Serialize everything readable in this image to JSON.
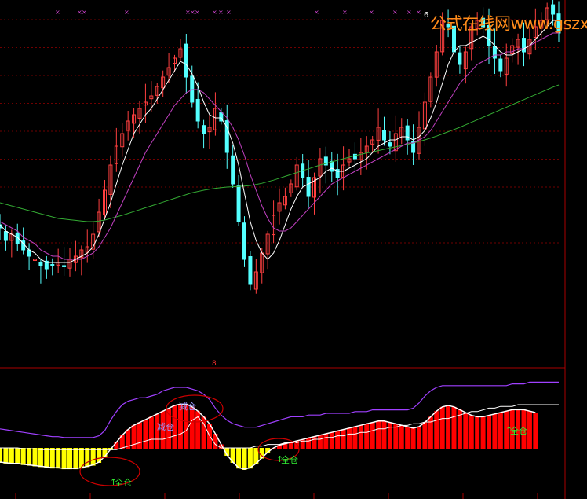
{
  "watermark": "公式在线网www.gszx.com.cn",
  "top_marker": "6",
  "panel_divider_marker": "8",
  "signals": {
    "reduce": "减仓",
    "full": "全仓"
  },
  "colors": {
    "bull_candle": "#ff4040",
    "bear_candle": "#54ffff",
    "ma_white": "#ffffff",
    "ma_purple": "#c040c0",
    "ma_green": "#33aa33",
    "hist_red": "#ff0000",
    "hist_yellow": "#ffff00",
    "line_purple": "#a040ff",
    "line_white": "#ffffff",
    "circle_red": "#cc0000",
    "grid": "#700000",
    "watermark": "#ff8c1a",
    "signal_full": "#33ee33",
    "signal_reduce": "#9999ff"
  },
  "chart_data": [
    {
      "type": "candlestick",
      "title": "",
      "ylim": [
        0,
        100
      ],
      "close": [
        40,
        36,
        38,
        35,
        33,
        31,
        30,
        28,
        27,
        28,
        29,
        28,
        30,
        31,
        33,
        34,
        38,
        45,
        52,
        60,
        66,
        70,
        74,
        76,
        78,
        80,
        82,
        85,
        88,
        91,
        94,
        97,
        88,
        80,
        74,
        70,
        72,
        78,
        74,
        64,
        54,
        42,
        30,
        22,
        26,
        32,
        38,
        44,
        48,
        50,
        54,
        60,
        56,
        50,
        56,
        62,
        60,
        58,
        56,
        60,
        62,
        62,
        64,
        66,
        68,
        72,
        68,
        66,
        70,
        72,
        68,
        64,
        72,
        80,
        88,
        96,
        106,
        104,
        96,
        92,
        96,
        104,
        106,
        104,
        98,
        94,
        90,
        94,
        98,
        100,
        96,
        100,
        104,
        106,
        110,
        108,
        102
      ],
      "ma_fast": [
        41,
        39,
        38,
        37,
        35,
        33,
        32,
        30,
        29,
        29,
        29,
        29,
        29,
        30,
        31,
        32,
        34,
        38,
        43,
        48,
        54,
        60,
        65,
        70,
        73,
        76,
        78,
        81,
        84,
        87,
        90,
        93,
        92,
        89,
        85,
        80,
        76,
        75,
        75,
        72,
        67,
        60,
        51,
        42,
        36,
        32,
        30,
        32,
        36,
        41,
        46,
        50,
        53,
        54,
        55,
        56,
        58,
        59,
        58,
        58,
        59,
        60,
        61,
        62,
        64,
        66,
        67,
        68,
        68,
        69,
        69,
        68,
        69,
        71,
        75,
        80,
        86,
        92,
        96,
        98,
        98,
        99,
        100,
        101,
        100,
        98,
        96,
        95,
        95,
        96,
        97,
        98,
        100,
        102,
        104,
        106,
        106
      ],
      "ma_mid": [
        42,
        41,
        40,
        39,
        37,
        36,
        35,
        33,
        32,
        31,
        31,
        30,
        30,
        30,
        30,
        31,
        32,
        34,
        37,
        40,
        44,
        48,
        52,
        56,
        60,
        64,
        67,
        70,
        73,
        76,
        79,
        81,
        83,
        84,
        84,
        83,
        81,
        79,
        77,
        75,
        72,
        68,
        63,
        57,
        52,
        47,
        43,
        40,
        39,
        39,
        40,
        42,
        44,
        46,
        48,
        50,
        52,
        54,
        55,
        56,
        57,
        58,
        59,
        60,
        61,
        62,
        63,
        64,
        65,
        66,
        67,
        67,
        68,
        69,
        71,
        74,
        77,
        80,
        83,
        86,
        88,
        90,
        92,
        93,
        94,
        95,
        95,
        96,
        96,
        97,
        97,
        98,
        99,
        100,
        101,
        102,
        102
      ],
      "ma_slow": [
        48,
        47.5,
        47,
        46.5,
        46,
        45.5,
        45,
        44.5,
        44,
        43.5,
        43,
        42.8,
        42.6,
        42.4,
        42.2,
        42,
        42,
        42.2,
        42.5,
        43,
        43.5,
        44,
        44.6,
        45.2,
        45.8,
        46.4,
        47,
        47.6,
        48.2,
        48.8,
        49.4,
        50,
        50.6,
        51.2,
        51.6,
        52,
        52.3,
        52.6,
        52.8,
        53,
        53.1,
        53.2,
        53.3,
        53.5,
        53.8,
        54.2,
        54.7,
        55.2,
        55.8,
        56.4,
        57,
        57.6,
        58.2,
        58.8,
        59.4,
        60,
        60.5,
        61,
        61.5,
        62,
        62.5,
        63,
        63.4,
        63.8,
        64.2,
        64.6,
        65,
        65.4,
        65.8,
        66.2,
        66.6,
        67,
        67.5,
        68,
        68.6,
        69.2,
        69.9,
        70.6,
        71.3,
        72,
        72.8,
        73.6,
        74.4,
        75.2,
        76,
        76.8,
        77.6,
        78.4,
        79.2,
        80,
        80.8,
        81.6,
        82.4,
        83.2,
        84,
        84.8,
        85.5
      ]
    },
    {
      "type": "area",
      "title": "",
      "ylim": [
        0,
        100
      ],
      "histogram": [
        -20,
        -21,
        -22,
        -22,
        -23,
        -24,
        -25,
        -26,
        -27,
        -28,
        -28,
        -29,
        -29,
        -29,
        -28,
        -26,
        -24,
        -20,
        -12,
        -2,
        8,
        18,
        26,
        32,
        36,
        40,
        44,
        48,
        52,
        56,
        60,
        62,
        62,
        58,
        52,
        44,
        34,
        20,
        5,
        -10,
        -20,
        -28,
        -30,
        -28,
        -22,
        -14,
        -6,
        0,
        4,
        6,
        8,
        10,
        12,
        14,
        16,
        18,
        20,
        22,
        24,
        26,
        28,
        30,
        32,
        34,
        36,
        38,
        38,
        36,
        34,
        32,
        30,
        28,
        30,
        36,
        44,
        52,
        58,
        60,
        58,
        54,
        50,
        46,
        44,
        44,
        46,
        48,
        50,
        52,
        54,
        54,
        54,
        52,
        50
      ],
      "upper_line": [
        42,
        41,
        40,
        39,
        38,
        37,
        36,
        35,
        34,
        33,
        33,
        32,
        32,
        32,
        32,
        32,
        32,
        34,
        40,
        52,
        62,
        70,
        74,
        76,
        78,
        78,
        80,
        82,
        86,
        88,
        90,
        90,
        90,
        88,
        86,
        82,
        76,
        66,
        58,
        52,
        48,
        46,
        44,
        44,
        44,
        46,
        48,
        50,
        52,
        54,
        56,
        56,
        56,
        58,
        58,
        58,
        60,
        60,
        60,
        60,
        60,
        62,
        62,
        62,
        64,
        64,
        64,
        64,
        64,
        64,
        64,
        66,
        72,
        80,
        86,
        90,
        92,
        92,
        92,
        92,
        92,
        92,
        92,
        92,
        92,
        92,
        92,
        92,
        94,
        94,
        94,
        96,
        96,
        96,
        96,
        96,
        96
      ],
      "lower_line": [
        20,
        20,
        20,
        20,
        19,
        19,
        19,
        18,
        18,
        18,
        18,
        18,
        18,
        18,
        18,
        18,
        18,
        18,
        18,
        18,
        18,
        20,
        22,
        24,
        26,
        28,
        30,
        30,
        30,
        32,
        34,
        36,
        40,
        52,
        56,
        48,
        34,
        24,
        20,
        20,
        20,
        20,
        20,
        20,
        22,
        22,
        24,
        24,
        24,
        26,
        26,
        26,
        28,
        28,
        30,
        30,
        32,
        32,
        34,
        34,
        36,
        36,
        38,
        38,
        40,
        42,
        42,
        44,
        44,
        46,
        46,
        48,
        48,
        50,
        50,
        52,
        54,
        54,
        56,
        58,
        60,
        62,
        62,
        64,
        66,
        66,
        68,
        68,
        68,
        70,
        70,
        70,
        70,
        70,
        70,
        70,
        70
      ]
    }
  ]
}
